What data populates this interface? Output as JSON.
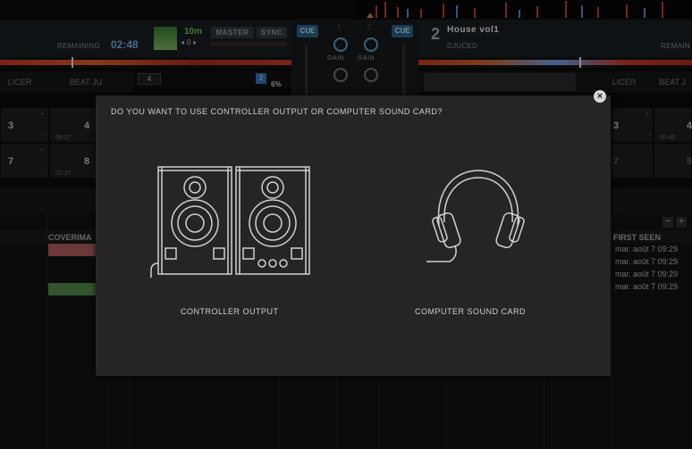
{
  "deck_left": {
    "remaining_label": "REMAINING",
    "remaining_time": "02:48",
    "loop_length": "10m",
    "loop_value": "0",
    "master_label": "MASTER",
    "sync_label": "SYNC",
    "pitch_value": "4",
    "pitch_percent": "6%",
    "key_badge": "2"
  },
  "mixer": {
    "cue_left": "CUE",
    "cue_right": "CUE",
    "channel_1": "1",
    "channel_2": "2",
    "gain_left": "GAIN",
    "gain_right": "GAIN"
  },
  "deck_right": {
    "deck_number": "2",
    "track_title": "House vol1",
    "artist": "DJUCED",
    "remaining_label": "REMAIN"
  },
  "tabs_left": [
    "LICER",
    "BEAT JU"
  ],
  "tabs_right": [
    "LICER",
    "BEAT J"
  ],
  "pads_left": [
    {
      "num": "3",
      "time": ""
    },
    {
      "num": "4",
      "time": "00:37"
    },
    {
      "num": "7",
      "time": ""
    },
    {
      "num": "8",
      "time": "01:37"
    }
  ],
  "pads_right": [
    {
      "num": "3",
      "time": ""
    },
    {
      "num": "4",
      "time": "00:45"
    },
    {
      "num": "7",
      "time": ""
    },
    {
      "num": "8",
      "time": ""
    }
  ],
  "browser": {
    "column_coverimage": "COVERIMA",
    "column_first_seen": "FIRST SEEN",
    "first_seen_values": [
      "mar. août 7 09:29",
      "mar. août 7 09:29",
      "mar. août 7 09:29",
      "mar. août 7 09:29"
    ],
    "minus_label": "−",
    "plus_label": "+"
  },
  "dialog": {
    "question": "DO YOU WANT TO USE CONTROLLER OUTPUT OR COMPUTER SOUND CARD?",
    "option_controller": "CONTROLLER OUTPUT",
    "option_soundcard": "COMPUTER SOUND CARD",
    "close_symbol": "×"
  },
  "icons": {
    "controller": "speakers-icon",
    "soundcard": "headphones-icon",
    "close": "close-icon"
  },
  "colors": {
    "dialog_bg": "#252525",
    "accent_blue": "#2a6f9c",
    "waveform_red": "#d9442a",
    "pad_red": "#c46868",
    "pad_green": "#5a9a52"
  }
}
